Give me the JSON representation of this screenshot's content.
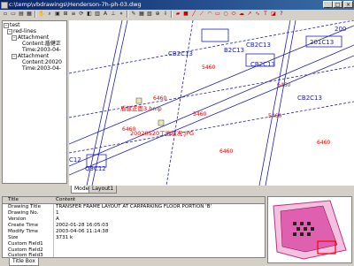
{
  "window": {
    "title": "c:\\temp\\vbdrawings\\Henderson-7h-ph-03.dwg"
  },
  "tree": {
    "root": "test",
    "layer": "red-lines",
    "attachments": [
      {
        "label": "Attachment",
        "content": "Content:盾健正",
        "time": "Time:2003-04-"
      },
      {
        "label": "Attachment",
        "content": "Content:20020",
        "time": "Time:2003-04-"
      }
    ]
  },
  "drawing": {
    "labels": [
      "CB2C13",
      "B2C13",
      "CB2C13",
      "CB2C13",
      "201C13",
      "200",
      "5460",
      "5460",
      "5460",
      "6460",
      "6460",
      "6460",
      "6460",
      "6460",
      "C12",
      "Q3C12",
      "CB2C13"
    ],
    "attachment_1": "盾健正面3.bmp",
    "attachment_2": "20020520工地状况.JPG",
    "accent_red": "#e00000",
    "line_blue": "#2020b0"
  },
  "layout_tabs": [
    "Model",
    "Layout1"
  ],
  "properties": {
    "header": [
      "Title",
      "Content"
    ],
    "rows": [
      {
        "key": "Drawing Title",
        "value": "TRANSFER FRAME LAYOUT AT CARPARKING FLOOR PORTION 'B'"
      },
      {
        "key": "Drawing No.",
        "value": "1"
      },
      {
        "key": "Version",
        "value": "A"
      },
      {
        "key": "Create Time",
        "value": "2002-01-28 16:05:03"
      },
      {
        "key": "Modify Time",
        "value": "2003-04-06 11:14:38"
      },
      {
        "key": "Size",
        "value": "3731 k"
      },
      {
        "key": "Custom Field1",
        "value": ""
      },
      {
        "key": "Custom Field2",
        "value": ""
      },
      {
        "key": "Custom Field3",
        "value": ""
      }
    ],
    "bottom_tab": "Title Box"
  }
}
